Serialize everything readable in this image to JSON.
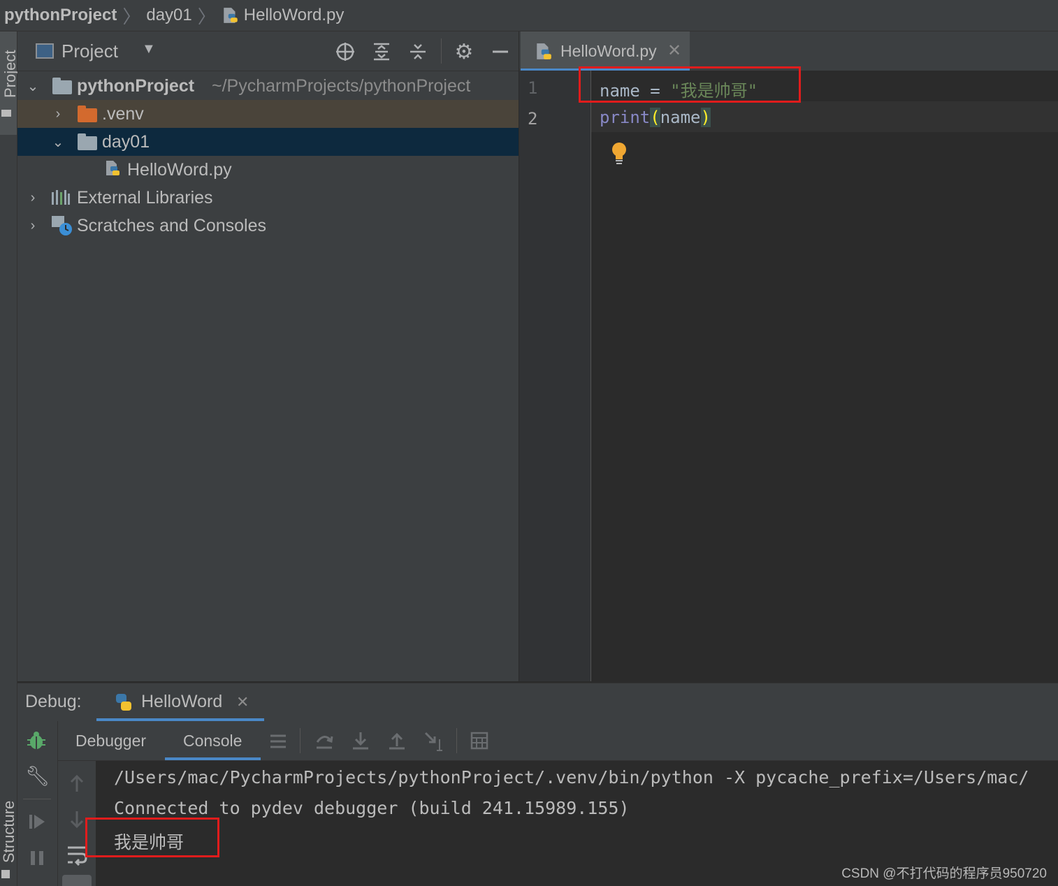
{
  "breadcrumb": {
    "project": "pythonProject",
    "folder": "day01",
    "file": "HelloWord.py"
  },
  "stripe": {
    "project_label": "Project",
    "structure_label": "Structure"
  },
  "project_panel": {
    "title": "Project",
    "tree": {
      "root_name": "pythonProject",
      "root_path": "~/PycharmProjects/pythonProject",
      "venv": ".venv",
      "day01": "day01",
      "file": "HelloWord.py",
      "external_libraries": "External Libraries",
      "scratches": "Scratches and Consoles"
    }
  },
  "editor": {
    "tab_label": "HelloWord.py",
    "line_numbers": [
      "1",
      "2"
    ],
    "line1": {
      "var": "name",
      "op": "=",
      "string": "\"我是帅哥\""
    },
    "line2": {
      "func": "print",
      "open": "(",
      "arg": "name",
      "close": ")"
    }
  },
  "debug": {
    "label": "Debug:",
    "tab": "HelloWord",
    "subtabs": {
      "debugger": "Debugger",
      "console": "Console"
    },
    "console_lines": [
      "/Users/mac/PycharmProjects/pythonProject/.venv/bin/python -X pycache_prefix=/Users/mac/",
      "Connected to pydev debugger (build 241.15989.155)",
      "我是帅哥"
    ]
  },
  "watermark": "CSDN @不打代码的程序员950720",
  "colors": {
    "accent_red": "#e01c1c",
    "selection": "#0d293e",
    "keyword": "#8888c6",
    "string": "#6a8759"
  }
}
